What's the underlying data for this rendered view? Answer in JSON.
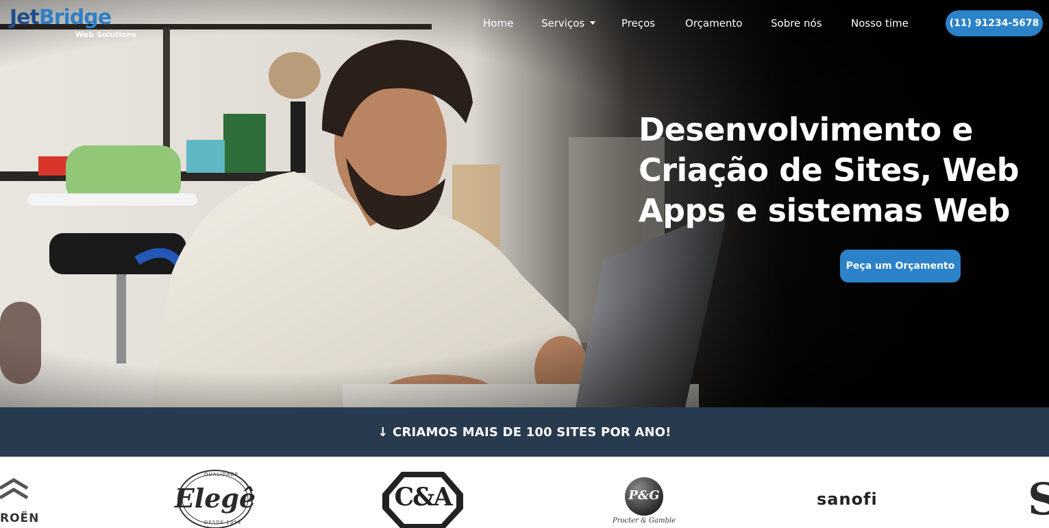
{
  "brand": {
    "name_part1": "Jet",
    "name_part2": "Bridge",
    "tagline": "Web Solutions"
  },
  "nav": {
    "items": [
      {
        "label": "Home"
      },
      {
        "label": "Serviços"
      },
      {
        "label": "Preços"
      },
      {
        "label": "Orçamento"
      },
      {
        "label": "Sobre nós"
      },
      {
        "label": "Nosso time"
      }
    ],
    "phone": "(11) 91234-5678"
  },
  "hero": {
    "headline_lines": [
      "Desenvolvimento e",
      "Criação de Sites, Web",
      "Apps e sistemas Web"
    ],
    "cta": "Peça um Orçamento"
  },
  "banner": {
    "text": "↓ CRIAMOS MAIS DE 100 SITES POR ANO!"
  },
  "clients": [
    {
      "name": "ROËN",
      "icon": "citroen-chevron-icon"
    },
    {
      "name": "Elegê",
      "badge_top": "QUALIDADE",
      "badge_bottom": "DESDE 1959"
    },
    {
      "name": "C&A"
    },
    {
      "name": "P&G",
      "subtitle": "Procter & Gamble"
    },
    {
      "name": "sanofi"
    },
    {
      "name": "S",
      "icon": "partial-logo-icon"
    }
  ],
  "colors": {
    "accent": "#2b82c9",
    "banner": "#283a4e",
    "logo_dark": "#1f4e8c"
  }
}
